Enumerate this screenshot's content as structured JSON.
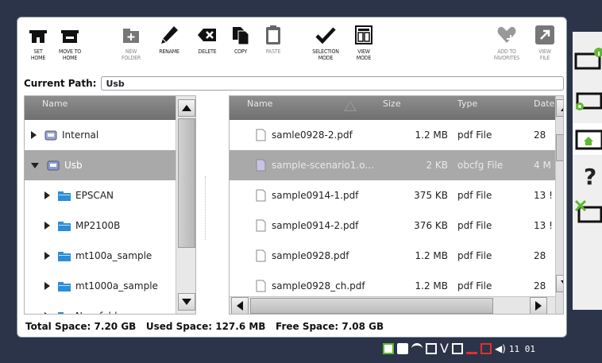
{
  "toolbar": {
    "set_home": "SET\nHOME",
    "move_to_home": "MOVE TO\nHOME",
    "new_folder": "NEW\nFOLDER",
    "rename": "RENAME",
    "delete": "DELETE",
    "copy": "COPY",
    "paste": "PASTE",
    "selection_mode": "SELECTION\nMODE",
    "view_mode": "VIEW\nMODE",
    "add_to_favorites": "ADD TO\nFAVORITES",
    "view_file": "VIEW\nFILE"
  },
  "path": {
    "label": "Current Path:",
    "value": "Usb"
  },
  "tree": {
    "header": "Name",
    "items": [
      {
        "label": "Internal",
        "expanded": false,
        "level": 0,
        "selected": false
      },
      {
        "label": "Usb",
        "expanded": true,
        "level": 0,
        "selected": true
      },
      {
        "label": "EPSCAN",
        "expanded": false,
        "level": 1,
        "selected": false
      },
      {
        "label": "MP2100B",
        "expanded": false,
        "level": 1,
        "selected": false
      },
      {
        "label": "mt100a_sample",
        "expanded": false,
        "level": 1,
        "selected": false
      },
      {
        "label": "mt1000a_sample",
        "expanded": false,
        "level": 1,
        "selected": false
      },
      {
        "label": "New folder",
        "expanded": false,
        "level": 1,
        "selected": false
      }
    ]
  },
  "files": {
    "columns": {
      "name": "Name",
      "size": "Size",
      "type": "Type",
      "date": "Date"
    },
    "rows": [
      {
        "name": "samle0928-2.pdf",
        "size": "1.2 MB",
        "type": "pdf File",
        "date": "28",
        "selected": false
      },
      {
        "name": "sample-scenario1.o...",
        "size": "2 KB",
        "type": "obcfg File",
        "date": "4 M",
        "selected": true
      },
      {
        "name": "sample0914-1.pdf",
        "size": "375 KB",
        "type": "pdf File",
        "date": "13 !",
        "selected": false
      },
      {
        "name": "sample0914-2.pdf",
        "size": "376 KB",
        "type": "pdf File",
        "date": "13 !",
        "selected": false
      },
      {
        "name": "sample0928.pdf",
        "size": "1.2 MB",
        "type": "pdf File",
        "date": "28",
        "selected": false
      },
      {
        "name": "sample0928_ch.pdf",
        "size": "1.2 MB",
        "type": "pdf File",
        "date": "28",
        "selected": false
      }
    ]
  },
  "status": {
    "total_label": "Total Space:",
    "total": "7.20 GB",
    "used_label": "Used Space:",
    "used": "127.6 MB",
    "free_label": "Free Space:",
    "free": "7.08 GB"
  },
  "tray": {
    "clock": "11 01"
  },
  "colors": {
    "background": "#2b3448",
    "header_gray": "#7f7f7f",
    "selection_gray": "#a9a9a9",
    "folder_blue": "#2a8fd8",
    "green_accent": "#5fb82e"
  }
}
